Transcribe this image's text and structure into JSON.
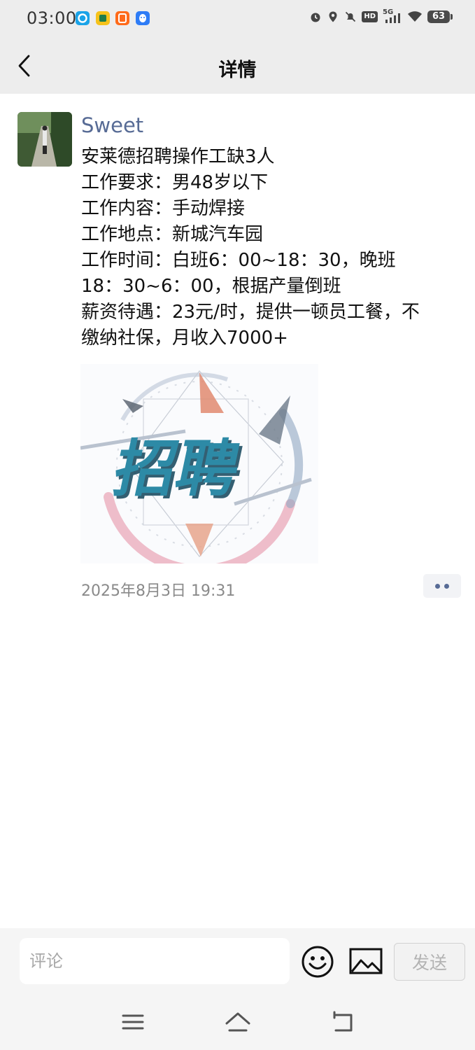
{
  "status_bar": {
    "time": "03:00",
    "app_icons": [
      "browser-icon",
      "game-app-icon",
      "taobao-icon",
      "qq-icon"
    ],
    "right_icons": [
      "alarm-icon",
      "location-icon",
      "mute-icon",
      "hd-icon",
      "signal-5g-icon",
      "wifi-icon"
    ],
    "network_label": "5G",
    "hd_label": "HD",
    "battery": "63"
  },
  "nav": {
    "title": "详情",
    "back_icon": "chevron-left-icon"
  },
  "post": {
    "author": "Sweet",
    "lines": [
      "安莱德招聘操作工缺3人",
      "工作要求：男48岁以下",
      "工作内容：手动焊接",
      "工作地点：新城汽车园",
      "工作时间：白班6：00~18：30，晚班",
      "18：30~6：00，根据产量倒班",
      "薪资待遇：23元/时，提供一顿员工餐，不",
      "缴纳社保，月收入7000+"
    ],
    "image_text": "招聘",
    "timestamp": "2025年8月3日 19:31"
  },
  "comment_bar": {
    "placeholder": "评论",
    "send_label": "发送"
  },
  "colors": {
    "author": "#576b95",
    "header_bg": "#ededed",
    "image_teal": "#2d7f9a"
  }
}
